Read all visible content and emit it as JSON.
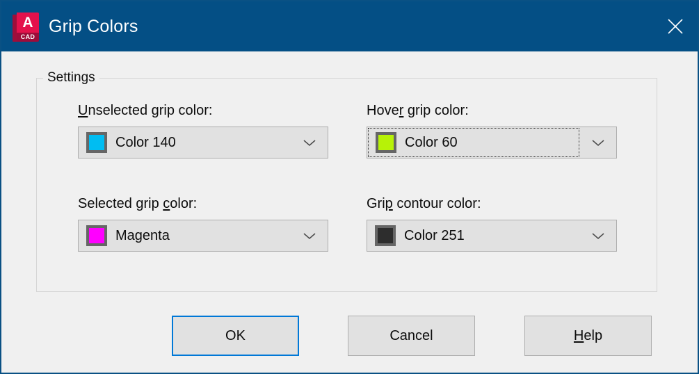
{
  "window": {
    "title": "Grip Colors",
    "logo": {
      "icon": "autocad-logo-icon",
      "letter": "A",
      "sub": "CAD"
    },
    "close_icon": "close-icon",
    "titlebar_color": "#044f85",
    "border_color": "#0a5184",
    "client_bg": "#f0f0f0"
  },
  "groupbox": {
    "legend": "Settings"
  },
  "fields": [
    {
      "id": "unselected-grip-color",
      "label_pre": "",
      "label_accel": "U",
      "label_post": "nselected grip color:",
      "value": "Color 140",
      "swatch_color": "#00bdf2",
      "swatch_border": "#666666",
      "focused": false,
      "arrow_icon": "chevron-down-icon"
    },
    {
      "id": "hover-grip-color",
      "label_pre": "Hove",
      "label_accel": "r",
      "label_post": " grip color:",
      "value": "Color 60",
      "swatch_color": "#b7f207",
      "swatch_border": "#666666",
      "focused": true,
      "arrow_icon": "chevron-down-icon"
    },
    {
      "id": "selected-grip-color",
      "label_pre": "Selected grip ",
      "label_accel": "c",
      "label_post": "olor:",
      "value": "Magenta",
      "swatch_color": "#ff00ff",
      "swatch_border": "#666666",
      "focused": false,
      "arrow_icon": "chevron-down-icon"
    },
    {
      "id": "grip-contour-color",
      "label_pre": "Gri",
      "label_accel": "p",
      "label_post": " contour color:",
      "value": "Color 251",
      "swatch_color": "#2d2d2d",
      "swatch_border": "#666666",
      "focused": false,
      "arrow_icon": "chevron-down-icon"
    }
  ],
  "buttons": {
    "ok": {
      "label": "OK",
      "default": true,
      "accent": "#0078d7"
    },
    "cancel": {
      "label": "Cancel",
      "default": false
    },
    "help": {
      "label_pre": "",
      "label_accel": "H",
      "label_post": "elp",
      "default": false
    }
  }
}
